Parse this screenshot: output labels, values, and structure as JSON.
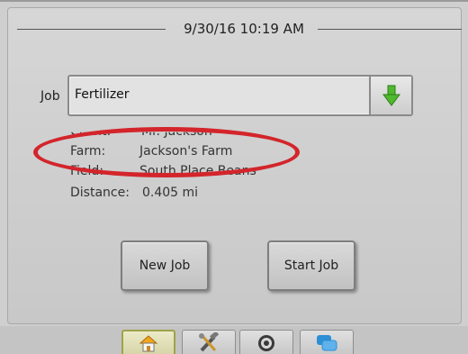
{
  "header": {
    "datetime": "9/30/16 10:19 AM"
  },
  "job": {
    "label": "Job",
    "value": "Fertilizer"
  },
  "details": {
    "client_label": "Client:",
    "client_value": "Mr. Jackson",
    "farm_label": "Farm:",
    "farm_value": "Jackson's Farm",
    "field_label": "Field:",
    "field_value": "South Place Beans",
    "distance_label": "Distance:",
    "distance_value": "0.405 mi"
  },
  "buttons": {
    "new_job": "New Job",
    "start_job": "Start Job"
  },
  "tabs": [
    {
      "icon": "home-icon"
    },
    {
      "icon": "tools-icon"
    },
    {
      "icon": "target-icon"
    },
    {
      "icon": "chat-icon"
    }
  ],
  "colors": {
    "highlight": "#d3252b",
    "arrow_green": "#4fb82f",
    "chat_blue": "#2d8fd6"
  }
}
